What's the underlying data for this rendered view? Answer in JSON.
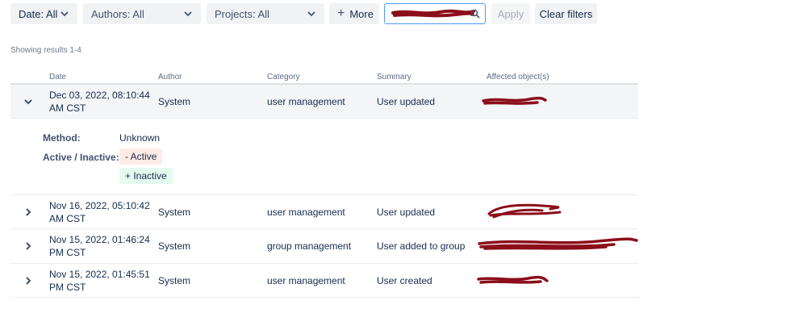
{
  "filters": {
    "date_label": "Date: All",
    "authors_label": "Authors: All",
    "projects_label": "Projects: All",
    "more_label": "More",
    "apply_label": "Apply",
    "clear_label": "Clear filters"
  },
  "showing_text": "Showing results 1-4",
  "columns": [
    "Date",
    "Author",
    "Category",
    "Summary",
    "Affected object(s)"
  ],
  "rows": [
    {
      "date_line1": "Dec 03, 2022, 08:10:44",
      "date_line2": "AM CST",
      "author": "System",
      "category": "user management",
      "summary": "User updated",
      "expanded": true
    },
    {
      "date_line1": "Nov 16, 2022, 05:10:42",
      "date_line2": "AM CST",
      "author": "System",
      "category": "user management",
      "summary": "User updated",
      "expanded": false
    },
    {
      "date_line1": "Nov 15, 2022, 01:46:24",
      "date_line2": "PM CST",
      "author": "System",
      "category": "group management",
      "summary": "User added to group",
      "expanded": false
    },
    {
      "date_line1": "Nov 15, 2022, 01:45:51",
      "date_line2": "PM CST",
      "author": "System",
      "category": "user management",
      "summary": "User created",
      "expanded": false
    }
  ],
  "detail": {
    "method_label": "Method:",
    "method_value": "Unknown",
    "active_label": "Active / Inactive:",
    "removed_value": "- Active",
    "added_value": "+ Inactive"
  },
  "colors": {
    "redaction": "#8b0e1a",
    "search_border": "#4c9aff",
    "removed_bg": "#ffebe6",
    "added_bg": "#e3fcef"
  },
  "icons": {
    "filter_dropdown": "chevron-down-icon",
    "more": "plus-icon",
    "search": "search-icon",
    "row_expanded": "chevron-down-icon",
    "row_collapsed": "chevron-right-icon"
  }
}
